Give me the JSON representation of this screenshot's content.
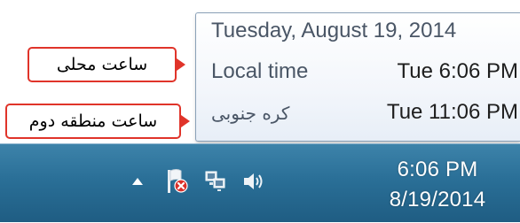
{
  "flyout": {
    "date": "Tuesday, August 19, 2014",
    "rows": [
      {
        "label": "Local time",
        "value": "Tue 6:06 PM"
      },
      {
        "label": "کره جنوبی",
        "value": "Tue 11:06 PM"
      }
    ]
  },
  "callouts": [
    {
      "text": "ساعت محلی"
    },
    {
      "text": "ساعت منطقه دوم"
    }
  ],
  "taskbar": {
    "clock_time": "6:06 PM",
    "clock_date": "8/19/2014",
    "tray_icons": [
      "show-hidden-icons-arrow-icon",
      "action-center-flag-icon",
      "network-icon",
      "speaker-volume-icon"
    ]
  },
  "colors": {
    "taskbar": "#2a6f97",
    "callout_border": "#e0342a",
    "flyout_text": "#4a5666"
  }
}
